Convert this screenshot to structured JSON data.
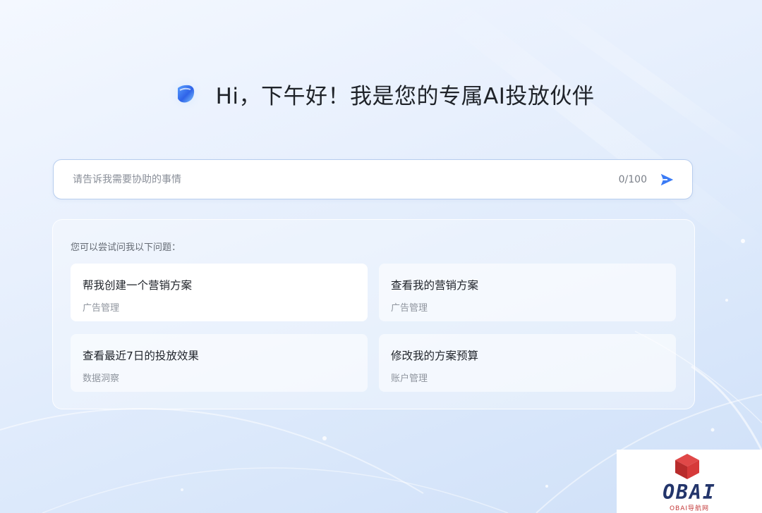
{
  "hero": {
    "title": "Hi，下午好！我是您的专属AI投放伙伴"
  },
  "input": {
    "placeholder": "请告诉我需要协助的事情",
    "value": "",
    "counter": "0/100",
    "send_icon": "send-icon"
  },
  "suggestions": {
    "heading": "您可以尝试问我以下问题：",
    "items": [
      {
        "title": "帮我创建一个营销方案",
        "category": "广告管理"
      },
      {
        "title": "查看我的营销方案",
        "category": "广告管理"
      },
      {
        "title": "查看最近7日的投放效果",
        "category": "数据洞察"
      },
      {
        "title": "修改我的方案预算",
        "category": "账户管理"
      }
    ]
  },
  "watermark": {
    "brand": "OBAI",
    "subtitle": "OBAI导航网"
  },
  "colors": {
    "accent": "#3b7bf5",
    "title_text": "#1f2329",
    "secondary_text": "#8f959e",
    "input_border": "#b7cdee",
    "watermark_brand": "#23356b",
    "watermark_cube": "#d63a3a"
  }
}
